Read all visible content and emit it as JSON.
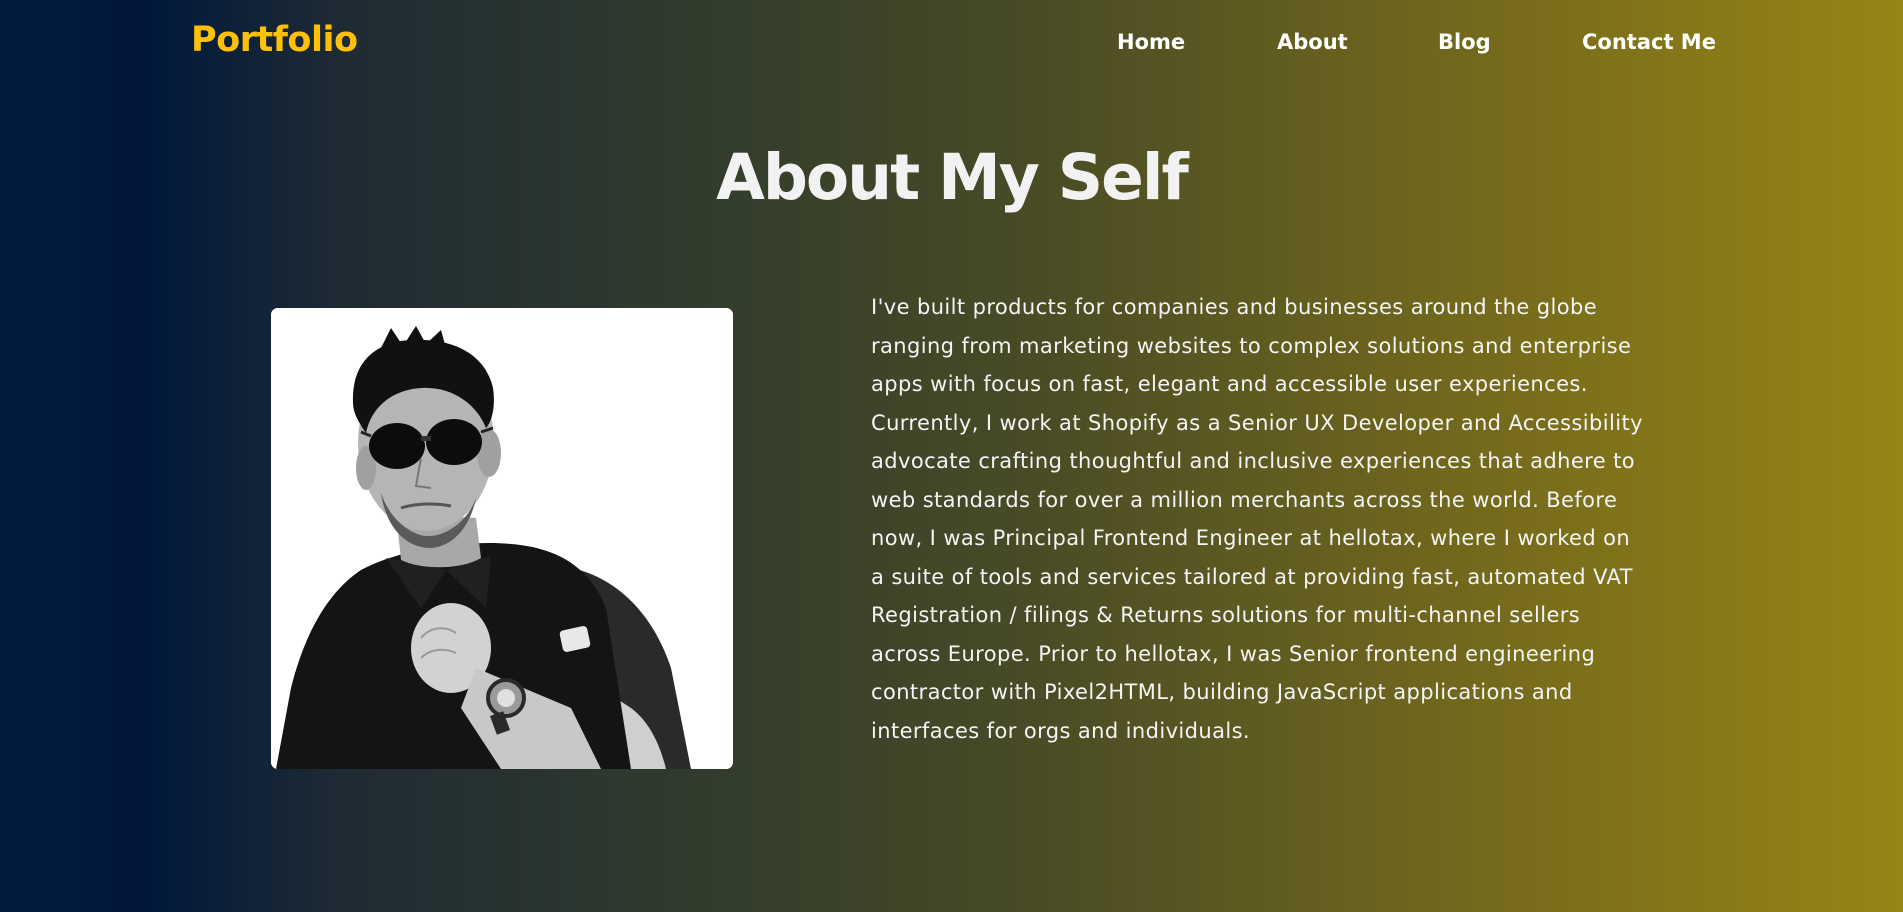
{
  "nav": {
    "brand": "Portfolio",
    "links": [
      {
        "label": "Home"
      },
      {
        "label": "About"
      },
      {
        "label": "Blog"
      },
      {
        "label": "Contact Me"
      }
    ]
  },
  "about": {
    "title": "About My Self",
    "bio": "I've built products for companies and businesses around the globe ranging from marketing websites to complex solutions and enterprise apps with focus on fast, elegant and accessible user experiences. Currently, I work at Shopify as a Senior UX Developer and Accessibility advocate crafting thoughtful and inclusive experiences that adhere to web standards for over a million merchants across the world. Before now, I was Principal Frontend Engineer at hellotax, where I worked on a suite of tools and services tailored at providing fast, automated VAT Registration / filings & Returns solutions for multi-channel sellers across Europe. Prior to hellotax, I was Senior frontend engineering contractor with Pixel2HTML, building JavaScript applications and interfaces for orgs and individuals."
  },
  "colors": {
    "brand": "#ffc107",
    "gradient_start": "#001a3c",
    "gradient_end": "#978515",
    "text": "#f2f2f2"
  }
}
